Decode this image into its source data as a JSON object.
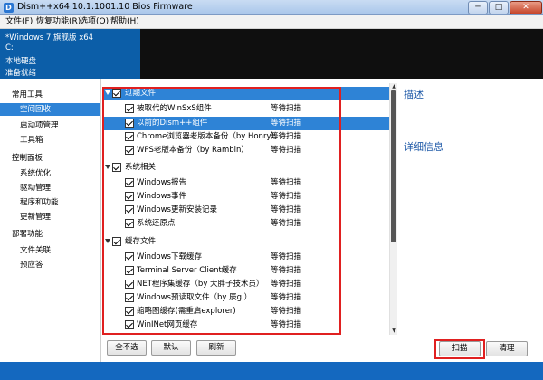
{
  "window": {
    "title": "Dism++x64 10.1.1001.10 Bios Firmware",
    "icon": "app-icon",
    "controls": [
      "─",
      "□",
      "✕"
    ]
  },
  "menu": [
    {
      "label": "文件(F)"
    },
    {
      "label": "恢复功能(R)"
    },
    {
      "label": "选项(O)"
    },
    {
      "label": "帮助(H)"
    }
  ],
  "system": {
    "name": "*Windows 7 旗舰版 x64",
    "drive": "C:",
    "disk": "本地硬盘",
    "status": "准备就绪"
  },
  "sidebar": {
    "groups": [
      {
        "label": "常用工具",
        "items": [
          {
            "label": "空间回收",
            "active": true
          },
          {
            "label": "启动项管理"
          },
          {
            "label": "工具箱"
          }
        ]
      },
      {
        "label": "控制面板",
        "items": [
          {
            "label": "系统优化"
          },
          {
            "label": "驱动管理"
          },
          {
            "label": "程序和功能"
          },
          {
            "label": "更新管理"
          }
        ]
      },
      {
        "label": "部署功能",
        "items": [
          {
            "label": "文件关联"
          },
          {
            "label": "预应答"
          }
        ]
      }
    ]
  },
  "list": {
    "groups": [
      {
        "label": "过期文件",
        "selected": true,
        "items": [
          {
            "label": "被取代的WinSxS组件",
            "status": "等待扫描"
          },
          {
            "label": "以前的Dism++组件",
            "status": "等待扫描",
            "selected": true
          },
          {
            "label": "Chrome浏览器老版本备份（by Honry）",
            "status": "等待扫描"
          },
          {
            "label": "WPS老版本备份（by Rambin）",
            "status": "等待扫描"
          }
        ]
      },
      {
        "label": "系统相关",
        "items": [
          {
            "label": "Windows报告",
            "status": "等待扫描"
          },
          {
            "label": "Windows事件",
            "status": "等待扫描"
          },
          {
            "label": "Windows更新安装记录",
            "status": "等待扫描"
          },
          {
            "label": "系统还原点",
            "status": "等待扫描"
          }
        ]
      },
      {
        "label": "缓存文件",
        "items": [
          {
            "label": "Windows下载缓存",
            "status": "等待扫描"
          },
          {
            "label": "Terminal Server Client缓存",
            "status": "等待扫描"
          },
          {
            "label": "NET程序集缓存（by 大胖子技术员）",
            "status": "等待扫描"
          },
          {
            "label": "Windows预读取文件（by 辰g.）",
            "status": "等待扫描"
          },
          {
            "label": "缩略图缓存(需重启explorer)",
            "status": "等待扫描"
          },
          {
            "label": "WinINet网页缓存",
            "status": "等待扫描"
          }
        ]
      }
    ]
  },
  "info": {
    "description_title": "描述",
    "details_title": "详细信息"
  },
  "buttons": {
    "deselect_all": "全不选",
    "default": "默认",
    "refresh": "刷新",
    "scan": "扫描",
    "clean": "清理"
  },
  "colors": {
    "accent": "#2e83d6",
    "header_blue": "#0c5ea8",
    "highlight_red": "#e02020",
    "status_bar": "#1468bf"
  }
}
